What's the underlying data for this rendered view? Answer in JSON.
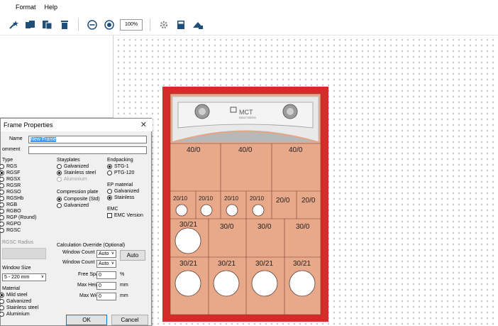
{
  "menu": [
    "Format",
    "Help"
  ],
  "toolbar": {
    "zoom": "100%"
  },
  "dialog": {
    "title": "Frame Properties",
    "name_label": "Name",
    "name_value": "New Frame",
    "comment_label": "omment",
    "type_header": "Type",
    "types": [
      "RGS",
      "RGSF",
      "RGSX",
      "RGSR",
      "RGSO",
      "RGSHb",
      "RGB",
      "RGBO",
      "RGP (Round)",
      "RGPO",
      "RGSC"
    ],
    "type_selected": 1,
    "rgsc_radius_label": "RGSC Radius",
    "window_size_label": "Window Size",
    "window_size_value": "5 - 220 mm",
    "material_label": "Material",
    "materials": [
      "Mild steel",
      "Galvanized",
      "Stainless steel",
      "Aluminium"
    ],
    "material_selected": 0,
    "stayplates_header": "Stayplates",
    "stayplates": [
      "Galvanized",
      "Stainless steel",
      "Aluminium"
    ],
    "stayplates_selected": 1,
    "endpacking_header": "Endpacking",
    "endpacking": [
      "STG-1",
      "PTG-120"
    ],
    "endpacking_selected": 0,
    "compression_header": "Compression plate",
    "compression": [
      "Composite (Std)",
      "Galvanized"
    ],
    "compression_selected": 0,
    "ep_material_header": "EP material",
    "ep_material": [
      "Galvanized",
      "Stainless"
    ],
    "ep_material_selected": 1,
    "emc_header": "EMC",
    "emc_version_label": "EMC Version",
    "calc_header": "Calculation Override (Optional)",
    "window_count_x_label": "Window Count X",
    "window_count_x_value": "Auto",
    "window_count_y_label": "Window Count Y",
    "window_count_y_value": "Auto",
    "auto_button": "Auto",
    "free_space_label": "Free Space",
    "free_space_value": "0",
    "free_space_unit": "%",
    "max_height_label": "Max Height",
    "max_height_value": "0",
    "max_height_unit": "mm",
    "max_width_label": "Max Width",
    "max_width_value": "0",
    "max_width_unit": "mm",
    "ok_button": "OK",
    "cancel_button": "Cancel"
  },
  "frame": {
    "brand": "MCT",
    "brand_sub": "BRATTBERG",
    "colors": {
      "border": "#d62b2b",
      "fill": "#e8a88a",
      "header": "#e9e9e9"
    },
    "row1": [
      "40/0",
      "40/0",
      "40/0"
    ],
    "row2": [
      "20/10",
      "20/10",
      "20/10",
      "20/10",
      "20/0",
      "20/0"
    ],
    "row3": [
      "30/21",
      "30/0",
      "30/0",
      "30/0"
    ],
    "row4": [
      "30/21",
      "30/21",
      "30/21",
      "30/21"
    ]
  }
}
